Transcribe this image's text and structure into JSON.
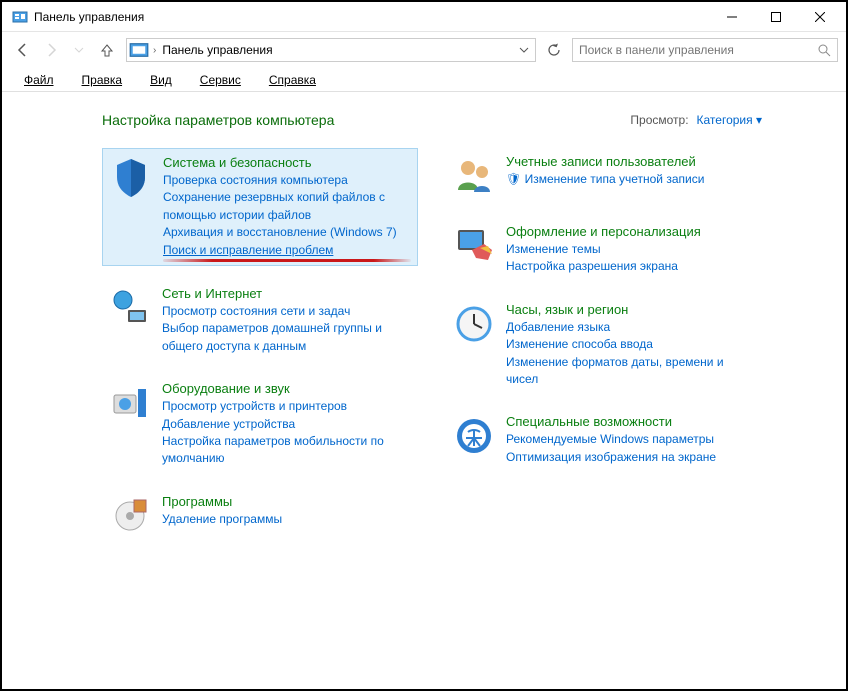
{
  "window": {
    "title": "Панель управления"
  },
  "address": {
    "crumb": "Панель управления"
  },
  "search": {
    "placeholder": "Поиск в панели управления"
  },
  "menu": {
    "file": "Файл",
    "edit": "Правка",
    "view": "Вид",
    "tools": "Сервис",
    "help": "Справка"
  },
  "header": {
    "title": "Настройка параметров компьютера",
    "view_label": "Просмотр:",
    "view_value": "Категория"
  },
  "left": [
    {
      "id": "system-security",
      "title": "Система и безопасность",
      "highlighted": true,
      "links": [
        "Проверка состояния компьютера",
        "Сохранение резервных копий файлов с помощью истории файлов",
        "Архивация и восстановление (Windows 7)",
        "Поиск и исправление проблем"
      ],
      "link_highlight_index": 3
    },
    {
      "id": "network-internet",
      "title": "Сеть и Интернет",
      "links": [
        "Просмотр состояния сети и задач",
        "Выбор параметров домашней группы и общего доступа к данным"
      ]
    },
    {
      "id": "hardware-sound",
      "title": "Оборудование и звук",
      "links": [
        "Просмотр устройств и принтеров",
        "Добавление устройства",
        "Настройка параметров мобильности по умолчанию"
      ]
    },
    {
      "id": "programs",
      "title": "Программы",
      "links": [
        "Удаление программы"
      ]
    }
  ],
  "right": [
    {
      "id": "user-accounts",
      "title": "Учетные записи пользователей",
      "links": [
        "🛡 Изменение типа учетной записи"
      ]
    },
    {
      "id": "appearance",
      "title": "Оформление и персонализация",
      "links": [
        "Изменение темы",
        "Настройка разрешения экрана"
      ]
    },
    {
      "id": "clock-region",
      "title": "Часы, язык и регион",
      "links": [
        "Добавление языка",
        "Изменение способа ввода",
        "Изменение форматов даты, времени и чисел"
      ]
    },
    {
      "id": "ease-of-access",
      "title": "Специальные возможности",
      "links": [
        "Рекомендуемые Windows параметры",
        "Оптимизация изображения на экране"
      ]
    }
  ]
}
